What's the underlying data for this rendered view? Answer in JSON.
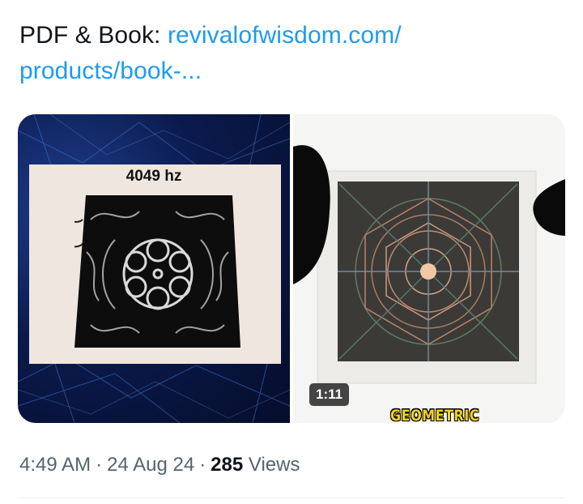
{
  "tweet": {
    "text_prefix": "PDF & Book: ",
    "link_text": "revivalofwisdom.com/ products/book-..."
  },
  "media": {
    "left": {
      "label": "4049 hz"
    },
    "right": {
      "duration": "1:11",
      "caption": "GEOMETRIC"
    }
  },
  "meta": {
    "time": "4:49 AM",
    "date": "24 Aug 24",
    "views_count": "285",
    "views_label": "Views",
    "separator": "·"
  },
  "colors": {
    "link": "#1d9bf0",
    "text": "#0f1419",
    "muted": "#536471",
    "caption": "#f3d21d"
  }
}
